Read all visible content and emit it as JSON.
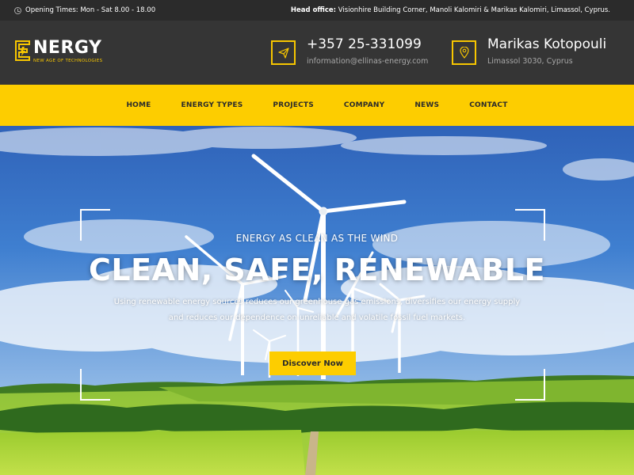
{
  "topbar": {
    "opening": "Opening Times: Mon - Sat 8.00 - 18.00",
    "head_office_label": "Head office:",
    "head_office_value": " Visionhire Building Corner, Manoli Kalomiri & Marikas Kalomiri, Limassol, Cyprus."
  },
  "logo": {
    "word": "NERGY",
    "tagline": "NEW AGE OF TECHNOLOGIES"
  },
  "contact": {
    "phone": "+357 25-331099",
    "email": "information@ellinas-energy.com",
    "street": "Marikas Kotopouli",
    "city": "Limassol 3030, Cyprus"
  },
  "nav": {
    "items": [
      "HOME",
      "ENERGY TYPES",
      "PROJECTS",
      "COMPANY",
      "NEWS",
      "CONTACT"
    ]
  },
  "hero": {
    "kicker": "ENERGY AS CLEAN AS THE WIND",
    "headline": "CLEAN, SAFE, RENEWABLE",
    "sub_line1": "Using renewable energy sources reduces our greenhouse gas emissions, diversifies our energy supply",
    "sub_line2": "and reduces our dependence on unreliable and volatile fossil fuel markets.",
    "cta": "Discover Now"
  },
  "colors": {
    "accent": "#fdcd00",
    "dark": "#2b2b2b",
    "header": "#353535"
  },
  "icons": {
    "topbar": "clock-icon",
    "phone_box": "paper-plane-icon",
    "address_box": "map-pin-icon",
    "logo": "energy-e-logo"
  }
}
